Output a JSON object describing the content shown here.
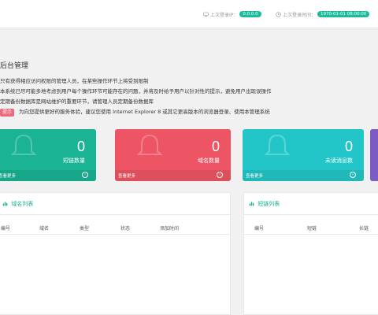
{
  "header": {
    "last_login_ip_label": "上次登录IP：",
    "last_login_ip": "0.0.0.0",
    "last_login_time_label": "上次登录时间：",
    "last_login_time": "1970-01-01 08:00:00"
  },
  "notice": {
    "title": "后台管理",
    "lines": [
      "只有获得相应访问权限的管理人员，在某些操作环节上将受到限制",
      "本系统已尽可能多地考虑到用户每个操作环节可能存在的问题，并将及时给予用户以针对性的提示，避免用户出现误操作",
      "定期备份数据库是网站维护的重要环节，请管理人员定期备份数据库"
    ],
    "tip_tag": "提示",
    "tip_text": "为向您提供更好的服务体验，建议您使用 Internet Explorer 8 或其它更高版本的浏览器登录、使用本管理系统"
  },
  "cards": [
    {
      "value": "0",
      "label": "短链数量",
      "more": "查看更多",
      "color": "#1ab394"
    },
    {
      "value": "0",
      "label": "域名数量",
      "more": "查看更多",
      "color": "#ed5565"
    },
    {
      "value": "0",
      "label": "未读消息数",
      "more": "查看更多",
      "color": "#23c6c8"
    }
  ],
  "domain_panel": {
    "title": "域名列表",
    "columns": [
      "编号",
      "域名",
      "类型",
      "状态",
      "添加时间"
    ]
  },
  "shortlink_panel": {
    "title": "短链列表",
    "columns": [
      "编号",
      "短链",
      "长链"
    ]
  }
}
